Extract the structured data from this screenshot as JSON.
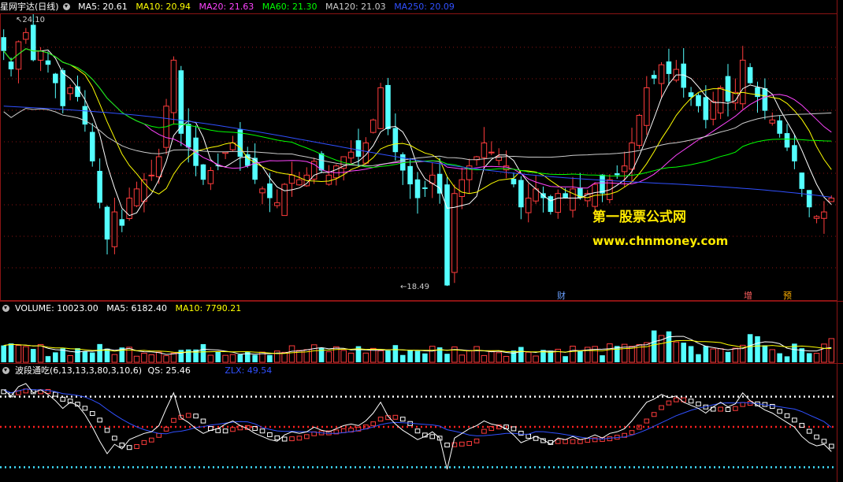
{
  "header": {
    "title": "星网宇达(日线)",
    "ma": [
      {
        "label": "MA5: 20.61",
        "color": "#ffffff"
      },
      {
        "label": "MA10: 20.94",
        "color": "#ffff00"
      },
      {
        "label": "MA20: 21.63",
        "color": "#ff44ff"
      },
      {
        "label": "MA60: 21.30",
        "color": "#00ff00"
      },
      {
        "label": "MA120: 21.03",
        "color": "#cccccc"
      },
      {
        "label": "MA250: 20.09",
        "color": "#3050ff"
      }
    ]
  },
  "volume_header": [
    {
      "label": "VOLUME: 10023.00",
      "color": "#ffffff"
    },
    {
      "label": "MA5: 6182.40",
      "color": "#ffffff"
    },
    {
      "label": "MA10: 7790.21",
      "color": "#ffff00"
    }
  ],
  "indicator_header": {
    "name": "波段通吃(6,13,13,3,80,3,10,6)",
    "qs": "QS: 25.46",
    "zlx": "ZLX: 49.54"
  },
  "annotations": {
    "high": "24.10",
    "low": "18.49"
  },
  "events": [
    {
      "label": "财",
      "color": "#6aa0ff",
      "date_index": 80
    },
    {
      "label": "增",
      "color": "#ff6060",
      "date_index": 106
    },
    {
      "label": "预",
      "color": "#ffb000",
      "date_index": 111
    }
  ],
  "watermark": {
    "line1": "第一股票公式网",
    "line2": "www.chnmoney.com"
  },
  "colors": {
    "up": "#ff3c3c",
    "down": "#54ffff",
    "bg": "#000000",
    "grid": "#8b1414"
  },
  "chart_data": [
    {
      "type": "candlestick",
      "title": "星网宇达(日线)",
      "ylim": [
        18.49,
        24.1
      ],
      "highest": 24.1,
      "lowest": 18.49,
      "series": [
        {
          "name": "MA5",
          "color": "#ffffff"
        },
        {
          "name": "MA10",
          "color": "#ffff00"
        },
        {
          "name": "MA20",
          "color": "#ff44ff"
        },
        {
          "name": "MA60",
          "color": "#00ff00"
        },
        {
          "name": "MA120",
          "color": "#cccccc"
        },
        {
          "name": "MA250",
          "color": "#3050ff"
        }
      ],
      "close": [
        23.6,
        23.2,
        23.8,
        24.0,
        23.4,
        23.6,
        23.3,
        22.9,
        22.4,
        22.8,
        22.6,
        22.0,
        21.2,
        20.3,
        19.5,
        20.1,
        19.8,
        20.4,
        20.6,
        20.8,
        20.9,
        21.3,
        22.4,
        23.4,
        21.8,
        21.5,
        21.1,
        20.8,
        21.0,
        21.1,
        21.4,
        21.6,
        21.3,
        21.1,
        20.8,
        20.6,
        20.4,
        20.3,
        20.7,
        20.9,
        20.8,
        20.9,
        21.2,
        21.0,
        20.9,
        21.1,
        21.3,
        21.4,
        21.3,
        21.6,
        22.1,
        22.8,
        21.9,
        21.4,
        21.0,
        20.7,
        20.4,
        20.6,
        20.9,
        20.5,
        18.5,
        20.5,
        20.8,
        21.1,
        21.3,
        21.6,
        21.4,
        21.3,
        21.1,
        20.7,
        20.2,
        20.4,
        20.6,
        20.4,
        20.1,
        20.5,
        20.4,
        20.6,
        20.4,
        20.5,
        20.7,
        20.5,
        20.8,
        20.9,
        21.1,
        21.6,
        22.2,
        22.8,
        23.0,
        23.3,
        23.1,
        23.2,
        22.8,
        22.6,
        22.4,
        22.1,
        22.5,
        22.8,
        22.5,
        22.7,
        23.4,
        22.9,
        22.6,
        22.3,
        22.1,
        21.8,
        21.5,
        21.2,
        20.6,
        20.2,
        20.0,
        20.1,
        20.4
      ],
      "volume_ma5": 6182.4,
      "volume_ma10": 7790.21,
      "volume_last": 10023.0
    },
    {
      "type": "line",
      "title": "波段通吃(6,13,13,3,80,3,10,6)",
      "series": [
        {
          "name": "QS",
          "last": 25.46,
          "color": "#ffffff"
        },
        {
          "name": "ZLX",
          "last": 49.54,
          "color": "#3050ff"
        }
      ],
      "reference_lines": [
        80,
        50,
        10
      ],
      "ylim": [
        0,
        100
      ]
    }
  ]
}
